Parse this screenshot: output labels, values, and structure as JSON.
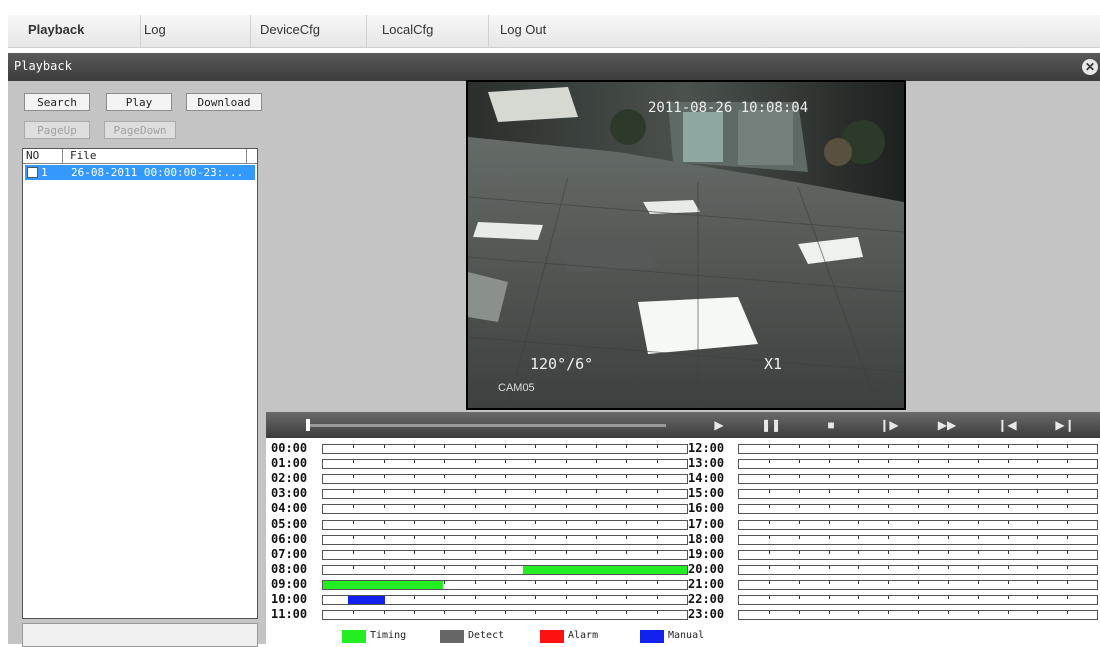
{
  "nav": {
    "items": [
      {
        "label": "Playback"
      },
      {
        "label": "Log"
      },
      {
        "label": "DeviceCfg"
      },
      {
        "label": "LocalCfg"
      },
      {
        "label": "Log Out"
      }
    ]
  },
  "window": {
    "title": "Playback",
    "close_icon": "close-icon"
  },
  "left_panel": {
    "buttons": {
      "search": "Search",
      "play": "Play",
      "download": "Download",
      "page_up": "PageUp",
      "page_down": "PageDown"
    },
    "list_headers": {
      "no": "NO",
      "file": "File"
    },
    "files": [
      {
        "no": "1",
        "name": "26-08-2011 00:00:00-23:...",
        "checked": false,
        "selected": true
      }
    ]
  },
  "video": {
    "timestamp": "2011-08-26 10:08:04",
    "ptz": "120°/6°",
    "zoom": "X1",
    "camera": "CAM05"
  },
  "controls": {
    "progress_fraction": 0.0,
    "icons": [
      "play-icon",
      "pause-icon",
      "stop-icon",
      "step-forward-icon",
      "fast-forward-icon",
      "skip-start-icon",
      "skip-end-icon"
    ]
  },
  "timeline": {
    "hours_left": [
      "00:00",
      "01:00",
      "02:00",
      "03:00",
      "04:00",
      "05:00",
      "06:00",
      "07:00",
      "08:00",
      "09:00",
      "10:00",
      "11:00"
    ],
    "hours_right": [
      "12:00",
      "13:00",
      "14:00",
      "15:00",
      "16:00",
      "17:00",
      "18:00",
      "19:00",
      "20:00",
      "21:00",
      "22:00",
      "23:00"
    ],
    "records": [
      {
        "hour": 8,
        "start": 0.55,
        "end": 1.0,
        "type": "timing"
      },
      {
        "hour": 9,
        "start": 0.0,
        "end": 0.33,
        "type": "timing"
      },
      {
        "hour": 10,
        "start": 0.07,
        "end": 0.17,
        "type": "manual"
      }
    ],
    "legend": [
      {
        "key": "timing",
        "label": "Timing",
        "color": "#22ee22"
      },
      {
        "key": "detect",
        "label": "Detect",
        "color": "#666666"
      },
      {
        "key": "alarm",
        "label": "Alarm",
        "color": "#ff1111"
      },
      {
        "key": "manual",
        "label": "Manual",
        "color": "#1122ee"
      }
    ]
  }
}
